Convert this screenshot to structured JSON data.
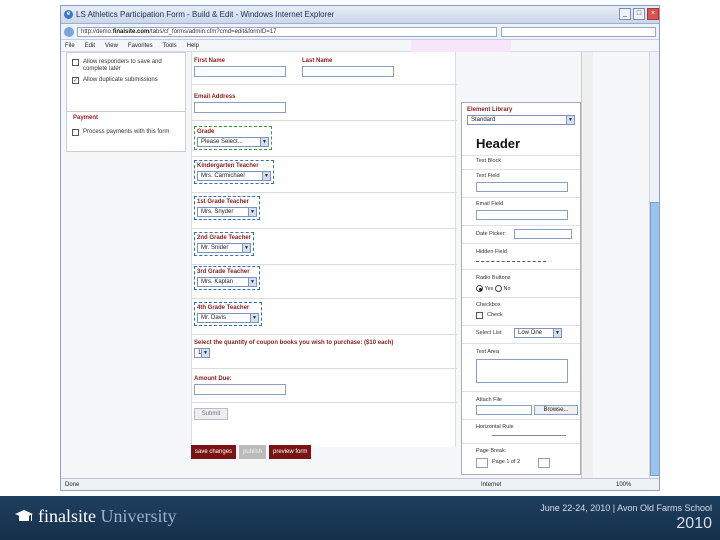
{
  "window": {
    "title": "LS Athletics Participation Form - Build & Edit - Windows Internet Explorer",
    "url_prefix": "http://demo.",
    "url_domain": "finalsite.com",
    "url_path": "/tabs/cf_forms/admin.cfm?cmd=edit&formID=17",
    "buttons": [
      "_",
      "□",
      "×"
    ]
  },
  "menu": [
    "File",
    "Edit",
    "View",
    "Favorites",
    "Tools",
    "Help"
  ],
  "left_panel": {
    "options": [
      {
        "text": "Allow responders to save and complete later",
        "checked": false
      },
      {
        "text": "Allow duplicate submissions",
        "checked": true
      }
    ],
    "payment_header": "Payment",
    "payment_option": "Process payments with this form"
  },
  "form": {
    "first_name": "First Name",
    "last_name": "Last Name",
    "email": "Email Address",
    "grade": {
      "label": "Grade",
      "value": "Please Select..."
    },
    "kindergarten": {
      "label": "Kindergarten Teacher",
      "value": "Mrs. Carmichael"
    },
    "first_grade": {
      "label": "1st Grade Teacher",
      "value": "Mrs. Snyder"
    },
    "second_grade": {
      "label": "2nd Grade Teacher",
      "value": "Mr. Snider"
    },
    "third_grade": {
      "label": "3rd Grade Teacher",
      "value": "Mrs. Kaplan"
    },
    "fourth_grade": {
      "label": "4th Grade Teacher",
      "value": "Mr. Davis"
    },
    "coupon": {
      "label": "Select the quantity of coupon books you wish to purchase: ($10 each)",
      "value": "1"
    },
    "amount_due": "Amount Due:",
    "submit": "Submit"
  },
  "actions": {
    "save": "save changes",
    "publish": "publish",
    "preview": "preview form"
  },
  "library": {
    "title": "Element Library",
    "selected": "Standard",
    "header": "Header",
    "text_block": "Text Block",
    "text_field": "Text Field",
    "email_field": "Email Field",
    "date_picker": "Date Picker:",
    "hidden_field": "Hidden Field",
    "radio_buttons": "Radio Buttons",
    "radio_yes": "Yes",
    "radio_no": "No",
    "checkbox": "Checkbox",
    "check": "Check",
    "select_list": "Select List",
    "select_value": "Low One",
    "text_area": "Text Area",
    "attach_file": "Attach File",
    "browse": "Browse...",
    "horizontal_rule": "Horizontal Rule",
    "page_break": "Page Break:",
    "page_of": "Page 1 of 2"
  },
  "status": {
    "left": "Done",
    "zone": "Internet",
    "zoom": "100%"
  },
  "footer": {
    "brand": "finalsite",
    "brand_suffix": "University",
    "event": "June 22-24, 2010 | Avon Old Farms School",
    "year": "2010"
  }
}
